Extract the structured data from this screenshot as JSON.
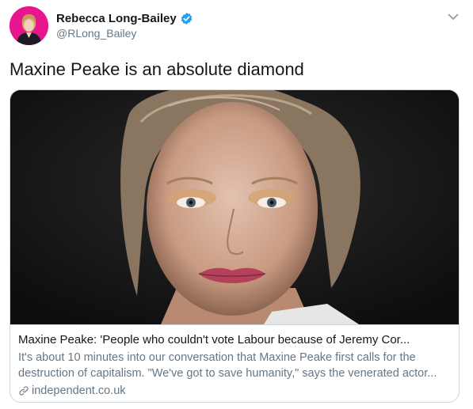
{
  "author": {
    "display_name": "Rebecca Long-Bailey",
    "handle": "@RLong_Bailey",
    "verified": true,
    "avatar_bg": "#e7168e"
  },
  "tweet": {
    "text": "Maxine Peake is an absolute diamond"
  },
  "card": {
    "title": "Maxine Peake: 'People who couldn't vote Labour because of Jeremy Cor...",
    "description": "It's about 10 minutes into our conversation that Maxine Peake first calls for the destruction of capitalism. \"We've got to save humanity,\" says the venerated actor...",
    "domain": "independent.co.uk"
  },
  "icons": {
    "verified": "verified-badge-icon",
    "caret": "chevron-down-icon",
    "link": "link-icon"
  },
  "colors": {
    "verified_blue": "#1da1f2",
    "secondary_text": "#657786",
    "border": "#ccd6dd"
  }
}
